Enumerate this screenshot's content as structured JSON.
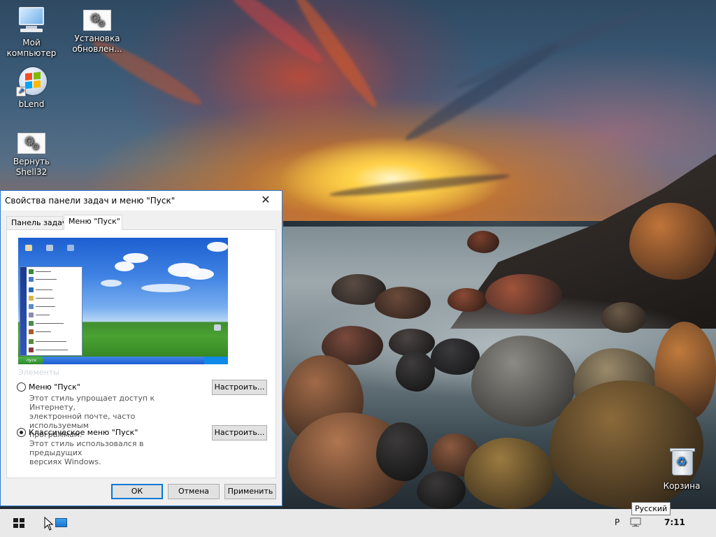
{
  "desktop": {
    "icons": [
      {
        "label_line1": "Мой",
        "label_line2": "компьютер"
      },
      {
        "label_line1": "Установка",
        "label_line2": "обновлен..."
      },
      {
        "label_line1": "bLend",
        "label_line2": ""
      },
      {
        "label_line1": "Вернуть",
        "label_line2": "Shell32"
      },
      {
        "label_line1": "Корзина",
        "label_line2": ""
      }
    ]
  },
  "dialog": {
    "title": "Свойства панели задач и меню \"Пуск\"",
    "close_glyph": "✕",
    "tabs": [
      {
        "label": "Панель задач",
        "active": false
      },
      {
        "label": "Меню \"Пуск\"",
        "active": true
      }
    ],
    "preview": {
      "start_label": "пуск"
    },
    "group_label": "Элементы",
    "options": [
      {
        "label": "Меню \"Пуск\"",
        "checked": false,
        "description_lines": [
          "Этот стиль упрощает доступ к Интернету,",
          "электронной почте, часто используемым",
          "программам."
        ],
        "button_label": "Настроить..."
      },
      {
        "label": "Классическое меню \"Пуск\"",
        "checked": true,
        "description_lines": [
          "Этот стиль использовался в предыдущих",
          "версиях Windows."
        ],
        "button_label": "Настроить..."
      }
    ],
    "buttons": {
      "ok": "ОК",
      "cancel": "Отмена",
      "apply": "Применить"
    }
  },
  "taskbar": {
    "language_indicator": "Р",
    "clock": "7:11",
    "tooltip": "Русский"
  },
  "colors": {
    "accent": "#0078d7",
    "dialog_border": "#2b7cd3",
    "taskbar": "#e9e9e9"
  }
}
